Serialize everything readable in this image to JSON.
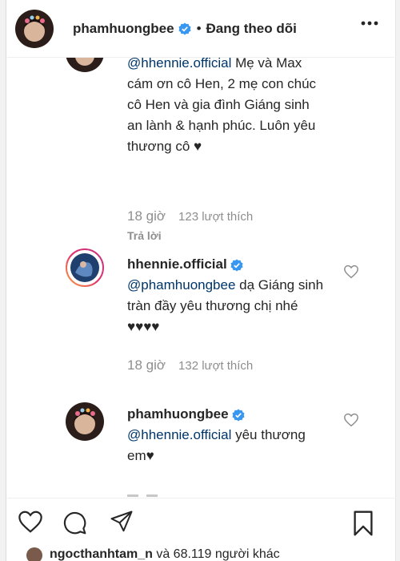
{
  "header": {
    "username": "phamhuongbee",
    "separator": "•",
    "follow_status": "Đang theo dõi"
  },
  "comments": [
    {
      "username": "",
      "mention": "@hhennie.official",
      "body": " Mẹ và Max cám ơn cô Hen, 2 mẹ con chúc cô Hen và gia đình Giáng sinh an lành & hạnh phúc. Luôn yêu thương cô ♥",
      "time": "18 giờ",
      "likes": "123 lượt thích",
      "reply": "Trả lời"
    },
    {
      "username": "hhennie.official",
      "mention": "@phamhuongbee",
      "body": " dạ Giáng sinh tràn đầy yêu thương chị nhé ♥♥♥♥",
      "time": "18 giờ",
      "likes": "132 lượt thích",
      "reply": ""
    },
    {
      "username": "phamhuongbee",
      "mention": "@hhennie.official",
      "body": " yêu thương em♥",
      "time": "",
      "likes": "",
      "reply": ""
    }
  ],
  "footer": {
    "liker": "ngocthanhtam_n",
    "liked_by_text": " và 68.119 người khác"
  },
  "colors": {
    "text": "#262626",
    "muted": "#8e8e8e",
    "link": "#003569",
    "verified": "#3897f0"
  },
  "icons": [
    "verified-badge-icon",
    "more-options-icon",
    "heart-icon",
    "comment-icon",
    "share-icon",
    "bookmark-icon"
  ]
}
